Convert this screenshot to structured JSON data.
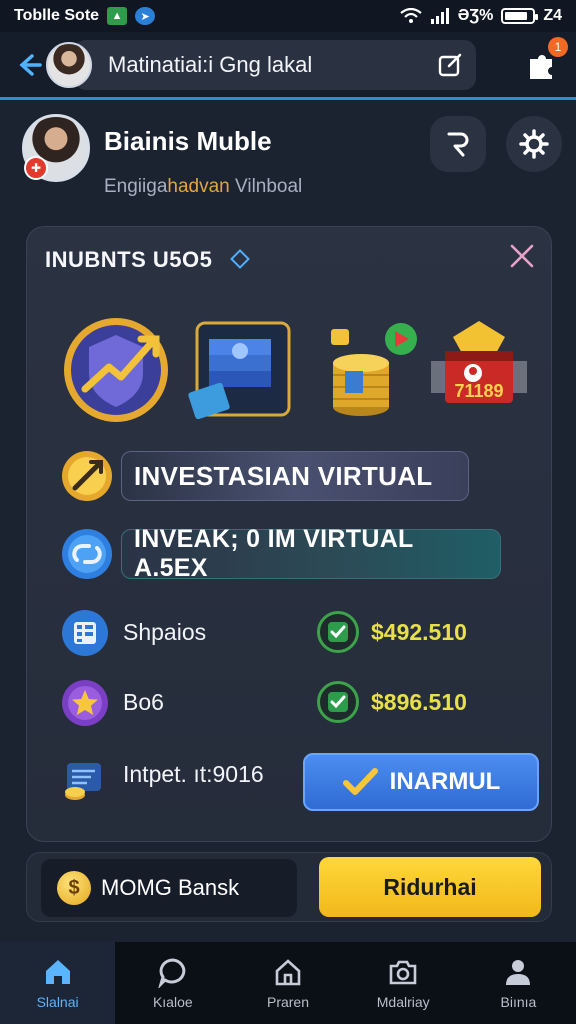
{
  "status_bar": {
    "left_text": "Toblle Sote",
    "right_text": "ƏƷ%",
    "time": "Z4"
  },
  "top_bar": {
    "search_text": "Matinatiai:i Gng lakal",
    "notification_count": "1"
  },
  "profile": {
    "name": "Biainis Muble",
    "subtitle_part1": "Engiiga",
    "subtitle_part2": "hadvan",
    "subtitle_part3": " Vilnboal"
  },
  "card": {
    "title": "INUBNTS U5O5",
    "feature_icons": [
      "investment-shield-icon",
      "cash-stack-icon",
      "coin-stack-icon",
      "treasure-chest-icon"
    ],
    "chest_label": "71189",
    "pill1": "INVESTASIAN VIRTUAL",
    "pill2": "INVEAK; 0  IM VIRTUAL A.5EX",
    "rows": [
      {
        "label": "Shpaios",
        "value": "$492.510"
      },
      {
        "label": "Bo6",
        "value": "$896.510"
      }
    ],
    "input_label": "Intpet. ıt:9016",
    "primary_button": "INARMUL"
  },
  "action_bar": {
    "bank_label": "MOMG Bansk",
    "button_label": "Ridurhai"
  },
  "nav": [
    {
      "label": "Slalnai",
      "icon": "home-icon",
      "active": true
    },
    {
      "label": "Kıaloe",
      "icon": "chat-bubble-icon",
      "active": false
    },
    {
      "label": "Praren",
      "icon": "home-outline-icon",
      "active": false
    },
    {
      "label": "Mdalriay",
      "icon": "camera-icon",
      "active": false
    },
    {
      "label": "Biınıa",
      "icon": "person-icon",
      "active": false
    }
  ],
  "colors": {
    "accent": "#2a8fd8",
    "value_yellow": "#e8e04a",
    "primary_blue": "#3b7be0",
    "cta_yellow": "#f5c62a"
  }
}
